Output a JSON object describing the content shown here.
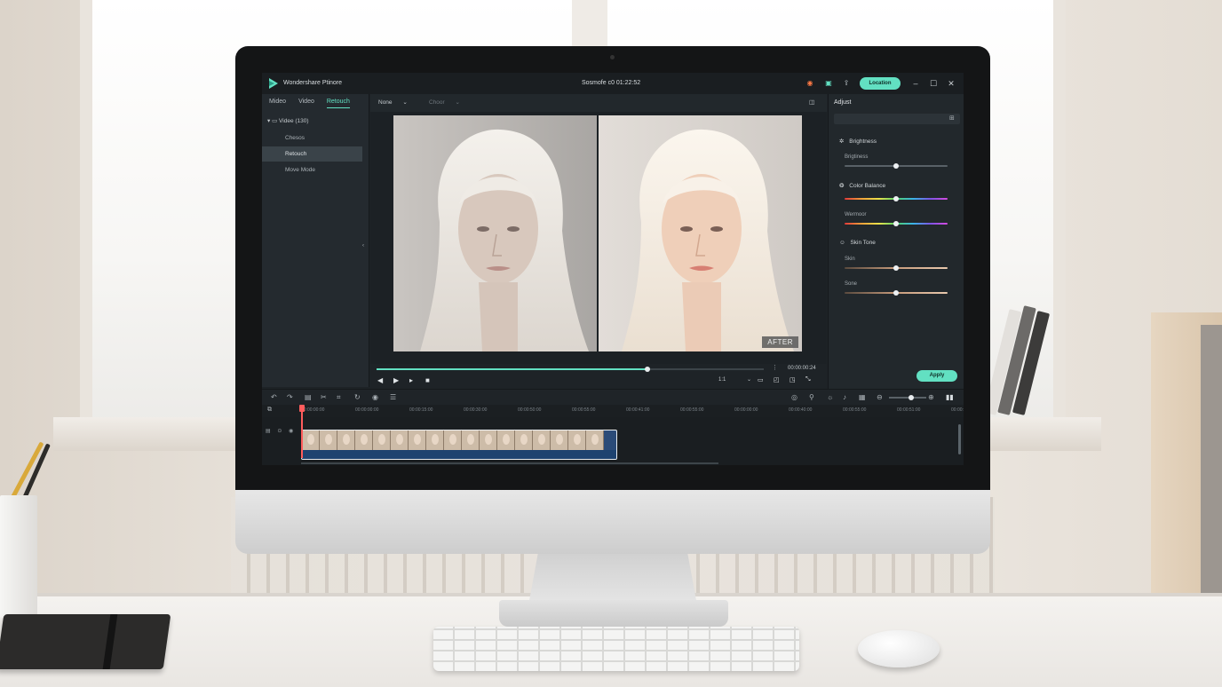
{
  "app": {
    "name": "Wondershare Ptinore",
    "document_title": "Sosmofe c0 01:22:52",
    "location_button": "Location",
    "accent_color": "#62e0c2"
  },
  "left_panel": {
    "tabs": [
      "Mideo",
      "Video",
      "Retouch"
    ],
    "active_tab": "Retouch",
    "tree_root": "Videe (130)",
    "items": [
      "Chesos",
      "Retouch",
      "Move Mode"
    ],
    "active_item": "Retouch"
  },
  "preview": {
    "filter_dropdown": "None",
    "secondary_dropdown": "Choor",
    "after_label": "AFTER",
    "timecode": "00:00:00:24",
    "progress": 0.7,
    "ratio": "1:1"
  },
  "adjust_panel": {
    "title": "Adjust",
    "sections": [
      {
        "title": "Brightness",
        "icon": "sun-icon",
        "sliders": [
          {
            "label": "Brigtiness",
            "value": 0.5,
            "style": "plain"
          }
        ]
      },
      {
        "title": "Color Balance",
        "icon": "color-circles-icon",
        "sliders": [
          {
            "label": "",
            "value": 0.5,
            "style": "color"
          },
          {
            "label": "Wermoor",
            "value": 0.5,
            "style": "color"
          }
        ]
      },
      {
        "title": "Skin Tone",
        "icon": "face-icon",
        "sliders": [
          {
            "label": "Skin",
            "value": 0.5,
            "style": "skin"
          },
          {
            "label": "Sone",
            "value": 0.5,
            "style": "skin"
          }
        ]
      }
    ],
    "apply_button": "Apply"
  },
  "timeline": {
    "ruler": [
      "00:00:00:00",
      "00:00:00:00",
      "00:00:15:00",
      "00:00:30:00",
      "00:00:50:00",
      "00:00:55:00",
      "00:00:41:00",
      "00:00:55:00",
      "00:00:00:00",
      "00:00:40:00",
      "00:00:55:00",
      "00:00:51:00",
      "00:00:"
    ],
    "clip_frames": 17
  }
}
